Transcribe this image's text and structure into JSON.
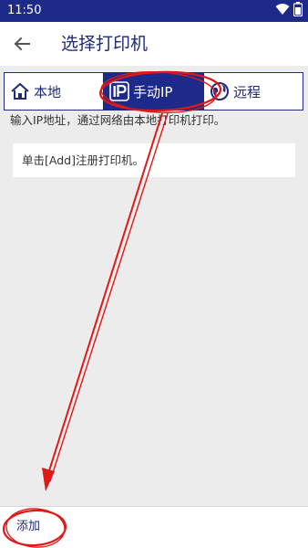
{
  "status_bar": {
    "time": "11:50",
    "icons": [
      "wifi-icon",
      "battery-icon"
    ]
  },
  "app_bar": {
    "title": "选择打印机",
    "back_icon": "arrow-left-icon"
  },
  "tabs": [
    {
      "label": "本地",
      "icon": "house-icon",
      "selected": false
    },
    {
      "label": "手动IP",
      "icon": "ip-icon",
      "selected": true
    },
    {
      "label": "远程",
      "icon": "globe-icon",
      "selected": false
    }
  ],
  "hint": "输入IP地址，通过网络由本地打印机打印。",
  "empty_list_text": "单击[Add]注册打印机。",
  "bottom_bar": {
    "add_label": "添加"
  },
  "colors": {
    "primary": "#1e2a8a",
    "title_text": "#1f2a7a",
    "background": "#ececec",
    "annotation": "#e01818"
  }
}
